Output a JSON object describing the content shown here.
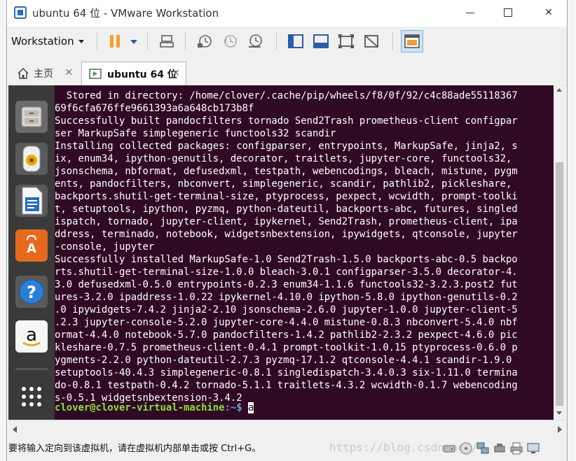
{
  "window": {
    "title": "ubuntu 64 位 - VMware Workstation",
    "minimize": "",
    "maximize": "",
    "close": "✕"
  },
  "toolbar": {
    "workstation_label": "Workstation"
  },
  "tabs": [
    {
      "label": "主页",
      "close": "✕"
    },
    {
      "label": "ubuntu 64 位",
      "close": "✕"
    }
  ],
  "terminal": {
    "lines": [
      "  Stored in directory: /home/clover/.cache/pip/wheels/f8/0f/92/c4c88ade55118367",
      "69f6cfa676ffe9661393a6a648cb173b8f",
      "Successfully built pandocfilters tornado Send2Trash prometheus-client configpar",
      "ser MarkupSafe simplegeneric functools32 scandir",
      "Installing collected packages: configparser, entrypoints, MarkupSafe, jinja2, s",
      "ix, enum34, ipython-genutils, decorator, traitlets, jupyter-core, functools32, ",
      "jsonschema, nbformat, defusedxml, testpath, webencodings, bleach, mistune, pygm",
      "ents, pandocfilters, nbconvert, simplegeneric, scandir, pathlib2, pickleshare, ",
      "backports.shutil-get-terminal-size, ptyprocess, pexpect, wcwidth, prompt-toolki",
      "t, setuptools, ipython, pyzmq, python-dateutil, backports-abc, futures, singled",
      "ispatch, tornado, jupyter-client, ipykernel, Send2Trash, prometheus-client, ipa",
      "ddress, terminado, notebook, widgetsnbextension, ipywidgets, qtconsole, jupyter",
      "-console, jupyter",
      "Successfully installed MarkupSafe-1.0 Send2Trash-1.5.0 backports-abc-0.5 backpo",
      "rts.shutil-get-terminal-size-1.0.0 bleach-3.0.1 configparser-3.5.0 decorator-4.",
      "3.0 defusedxml-0.5.0 entrypoints-0.2.3 enum34-1.1.6 functools32-3.2.3.post2 fut",
      "ures-3.2.0 ipaddress-1.0.22 ipykernel-4.10.0 ipython-5.8.0 ipython-genutils-0.2",
      ".0 ipywidgets-7.4.2 jinja2-2.10 jsonschema-2.6.0 jupyter-1.0.0 jupyter-client-5",
      ".2.3 jupyter-console-5.2.0 jupyter-core-4.4.0 mistune-0.8.3 nbconvert-5.4.0 nbf",
      "ormat-4.4.0 notebook-5.7.0 pandocfilters-1.4.2 pathlib2-2.3.2 pexpect-4.6.0 pic",
      "kleshare-0.7.5 prometheus-client-0.4.1 prompt-toolkit-1.0.15 ptyprocess-0.6.0 p",
      "ygments-2.2.0 python-dateutil-2.7.3 pyzmq-17.1.2 qtconsole-4.4.1 scandir-1.9.0 ",
      "setuptools-40.4.3 simplegeneric-0.8.1 singledispatch-3.4.0.3 six-1.11.0 termina",
      "do-0.8.1 testpath-0.4.2 tornado-5.1.1 traitlets-4.3.2 wcwidth-0.1.7 webencoding",
      "s-0.5.1 widgetsnbextension-3.4.2"
    ],
    "prompt_user": "clover@clover-virtual-machine",
    "prompt_path": ":~$ ",
    "command": "a"
  },
  "statusbar": {
    "text": "要将输入定向到该虚拟机，请在虚拟机内部单击或按 Ctrl+G。",
    "watermark": "https://blog.csdn.net/"
  },
  "colors": {
    "terminal_bg": "#300a24",
    "prompt_user": "#8ae234",
    "prompt_path": "#729fcf",
    "launcher_bg": "#3a3a3a"
  },
  "icons": {
    "launcher": [
      "files-icon",
      "rhythmbox-icon",
      "libreoffice-writer-icon",
      "software-center-icon",
      "help-icon",
      "amazon-icon",
      "app-grid-icon"
    ]
  }
}
